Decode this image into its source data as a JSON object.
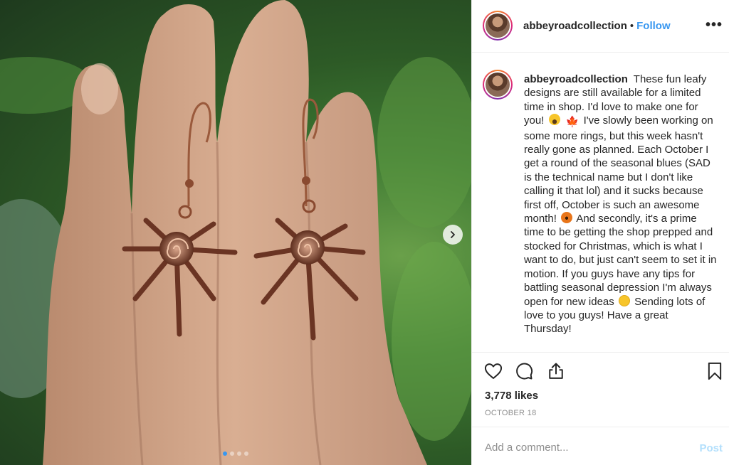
{
  "post": {
    "username": "abbeyroadcollection",
    "bullet": "•",
    "follow_label": "Follow",
    "more_label": "•••",
    "caption_parts": [
      "These fun leafy designs are still available for a limited time in shop. I'd love to make one for you!",
      "I've slowly been working on some more rings, but this week hasn't really gone as planned. Each October I get a round of the seasonal blues (SAD is the technical name but I don't like calling it that lol) and it sucks because first off, October is such an awesome month!",
      "And secondly, it's a prime time to be getting the shop prepped and stocked for Christmas, which is what I want to do, but just can't seem to set it in motion. If you guys have any tips for battling seasonal depression I'm always open for new ideas",
      "Sending lots of love to you guys! Have a great Thursday!"
    ],
    "maple_emoji": "🍁",
    "likes": "3,778 likes",
    "date": "OCTOBER 18",
    "comment_placeholder": "Add a comment...",
    "post_label": "Post"
  },
  "carousel": {
    "slide_count": 4,
    "active_index": 0,
    "next_icon": "chevron-right-icon"
  },
  "icons": {
    "like": "heart-icon",
    "comment": "comment-icon",
    "share": "share-icon",
    "save": "bookmark-icon"
  },
  "colors": {
    "accent": "#3897f0",
    "post_disabled": "#b2dffc",
    "muted": "#8e8e8e",
    "text": "#262626"
  }
}
